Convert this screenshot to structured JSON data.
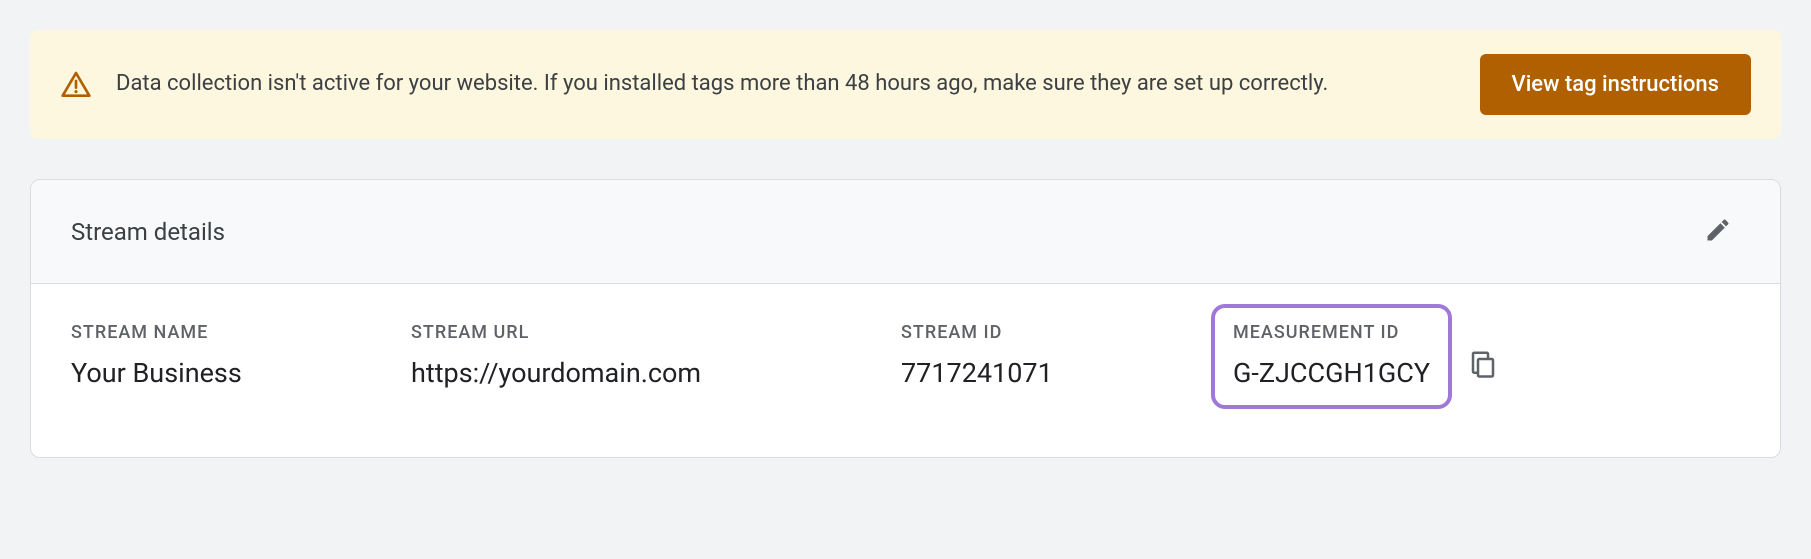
{
  "alert": {
    "message": "Data collection isn't active for your website. If you installed tags more than 48 hours ago, make sure they are set up correctly.",
    "button_label": "View tag instructions"
  },
  "stream_details": {
    "title": "Stream details",
    "fields": {
      "stream_name": {
        "label": "STREAM NAME",
        "value": "Your Business"
      },
      "stream_url": {
        "label": "STREAM URL",
        "value": "https://yourdomain.com"
      },
      "stream_id": {
        "label": "STREAM ID",
        "value": "7717241071"
      },
      "measurement_id": {
        "label": "MEASUREMENT ID",
        "value": "G-ZJCCGH1GCY"
      }
    }
  }
}
